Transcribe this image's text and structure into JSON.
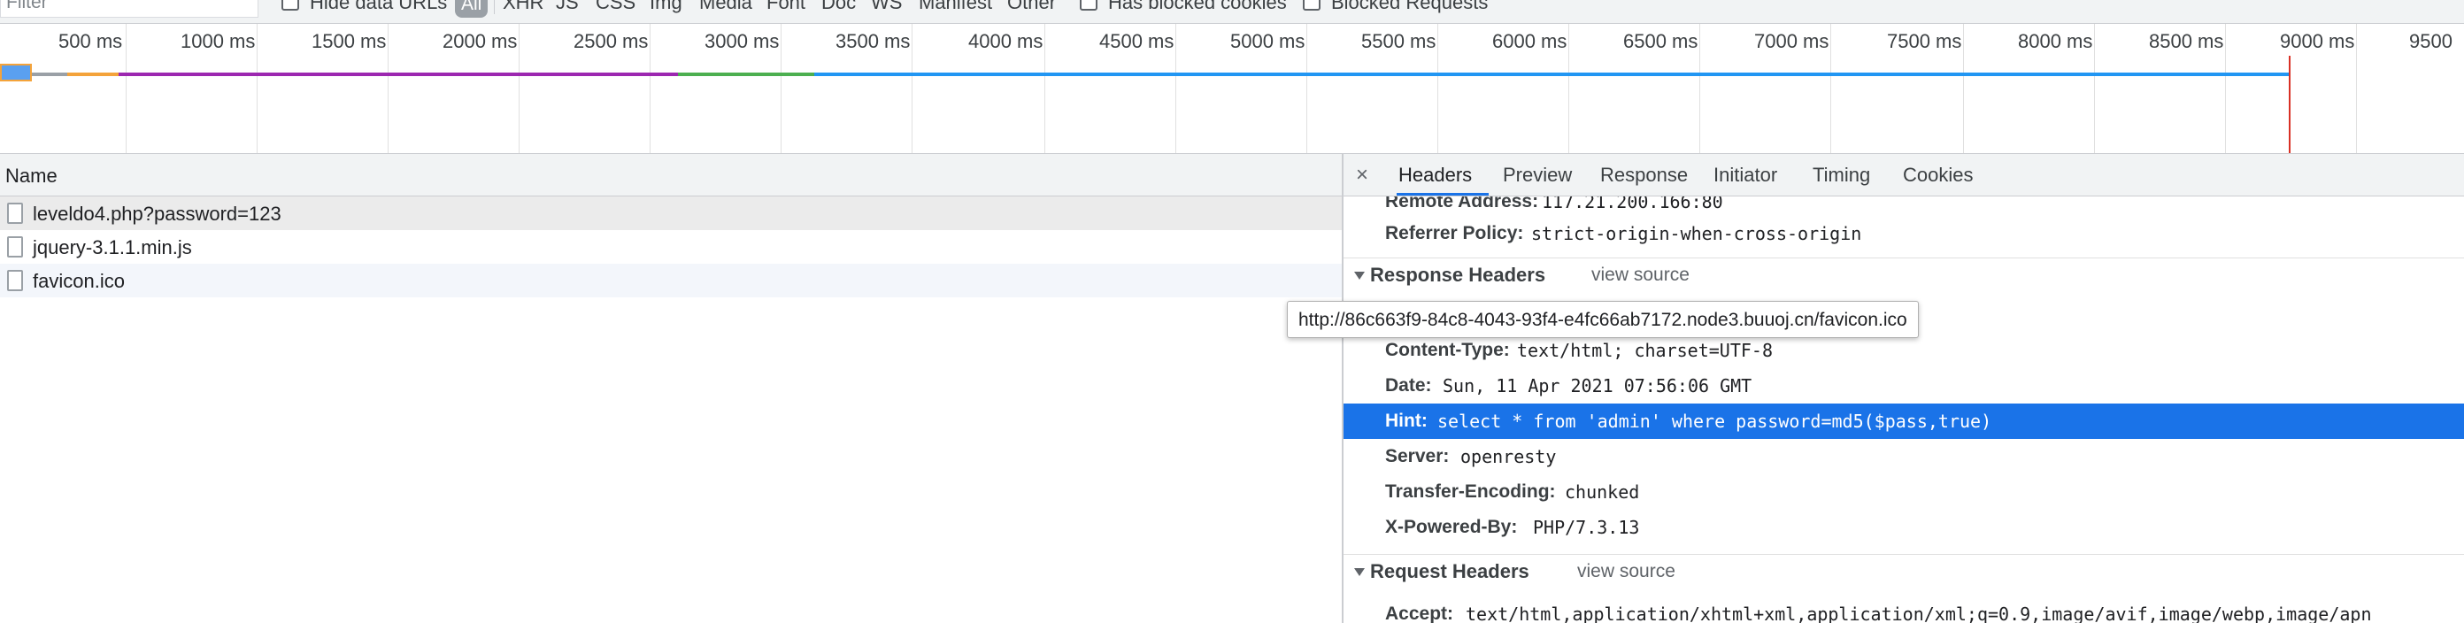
{
  "filter_bar": {
    "filter_placeholder": "Filter",
    "hide_data_urls_label": "Hide data URLs",
    "type_filters": [
      "All",
      "XHR",
      "JS",
      "CSS",
      "Img",
      "Media",
      "Font",
      "Doc",
      "WS",
      "Manifest",
      "Other"
    ],
    "has_blocked_cookies_label": "Has blocked cookies",
    "blocked_requests_label": "Blocked Requests"
  },
  "overview": {
    "tick_labels": [
      "500 ms",
      "1000 ms",
      "1500 ms",
      "2000 ms",
      "2500 ms",
      "3000 ms",
      "3500 ms",
      "4000 ms",
      "4500 ms",
      "5000 ms",
      "5500 ms",
      "6000 ms",
      "6500 ms",
      "7000 ms",
      "7500 ms",
      "8000 ms",
      "8500 ms",
      "9000 ms",
      "9500"
    ],
    "colors": {
      "waiting": "#9aa0a6",
      "connecting": "#f4a33a",
      "stalled": "#9c27b0",
      "ssl": "#4caf50",
      "download": "#2196f3",
      "load_event": "#d93025"
    }
  },
  "requests": {
    "column_name": "Name",
    "items": [
      {
        "name": "leveldo4.php?password=123"
      },
      {
        "name": "jquery-3.1.1.min.js"
      },
      {
        "name": "favicon.ico"
      }
    ]
  },
  "details": {
    "close_glyph": "×",
    "tabs": [
      "Headers",
      "Preview",
      "Response",
      "Initiator",
      "Timing",
      "Cookies"
    ],
    "general_partial": [
      {
        "key": "Remote Address:",
        "value": "117.21.200.166:80"
      },
      {
        "key": "Referrer Policy:",
        "value": "strict-origin-when-cross-origin"
      }
    ],
    "response_section_title": "Response Headers",
    "request_section_title": "Request Headers",
    "view_source_label": "view source",
    "response_headers": [
      {
        "key": "Content-Type:",
        "value": "text/html; charset=UTF-8"
      },
      {
        "key": "Date:",
        "value": "Sun, 11 Apr 2021 07:56:06 GMT"
      },
      {
        "key": "Hint:",
        "value": "select * from 'admin' where password=md5($pass,true)"
      },
      {
        "key": "Server:",
        "value": "openresty"
      },
      {
        "key": "Transfer-Encoding:",
        "value": "chunked"
      },
      {
        "key": "X-Powered-By:",
        "value": "PHP/7.3.13"
      }
    ],
    "request_headers": [
      {
        "key": "Accept:",
        "value": "text/html,application/xhtml+xml,application/xml;q=0.9,image/avif,image/webp,image/apn"
      }
    ]
  },
  "tooltip": {
    "text": "http://86c663f9-84c8-4043-93f4-e4fc66ab7172.node3.buuoj.cn/favicon.ico"
  },
  "colors": {
    "selection": "#1a73e8",
    "toolbar_bg": "#f1f3f4",
    "border": "#cbcdd1"
  }
}
